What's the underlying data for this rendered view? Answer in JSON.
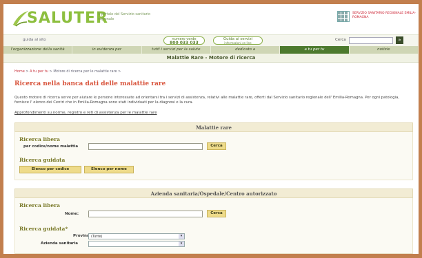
{
  "header": {
    "logo_text": "SALUTER",
    "logo_sub": "Il portale del Servizio sanitario regionale",
    "region_text": "SERVIZIO SANITARIO REGIONALE EMILIA-ROMAGNA"
  },
  "util": {
    "guida": "guida al sito",
    "phone_label": "numero verde",
    "phone_number": "800 033 033",
    "guide_label": "Guida ai servizi",
    "guide_sub": "informazioni on line",
    "search_label": "Cerca",
    "search_button": "»"
  },
  "nav": [
    {
      "label": "l'organizzazione della sanità"
    },
    {
      "label": "in evidenza per"
    },
    {
      "label": "tutti i servizi per la salute"
    },
    {
      "label": "dedicato a"
    },
    {
      "label": "a tu per tu"
    },
    {
      "label": "notizie"
    }
  ],
  "page_title": "Malattie Rare - Motore di ricerca",
  "breadcrumb": {
    "home": "Home",
    "sep1": ">",
    "a_tu": "A tu per tu",
    "sep2": ">",
    "current": "Motore di ricerca per le malattie rare >"
  },
  "heading": "Ricerca nella banca dati delle malattie rare",
  "intro": "Questo motore di ricerca serve per aiutare le persone interessate ad orientarsi tra i servizi di assistenza, relativi alle malattie rare, offerti dal Servizio sanitario regionale dell' Emilia-Romagna. Per ogni patologia, fornisce l' elenco dei Centri che in Emilia-Romagna sono stati individuati per la diagnosi e la cura.",
  "approf_link": "Approfondimenti su norme, registro e reti di assistenza per le malattie rare",
  "malattie": {
    "title": "Malattie rare",
    "libera": "Ricerca libera",
    "field_label": "per codice/nome malattia",
    "cerca": "Cerca",
    "guidata": "Ricerca guidata",
    "btn_codice": "Elenco per codice",
    "btn_nome": "Elenco per nome"
  },
  "azienda": {
    "title": "Azienda sanitaria/Ospedale/Centro autorizzato",
    "libera": "Ricerca libera",
    "nome_label": "Nome:",
    "cerca": "Cerca",
    "guidata": "Ricerca guidata*",
    "provincia_label": "Provincia",
    "provincia_value": "(Tutte)",
    "azienda_label": "Azienda sanitaria",
    "arrow": "▾"
  }
}
